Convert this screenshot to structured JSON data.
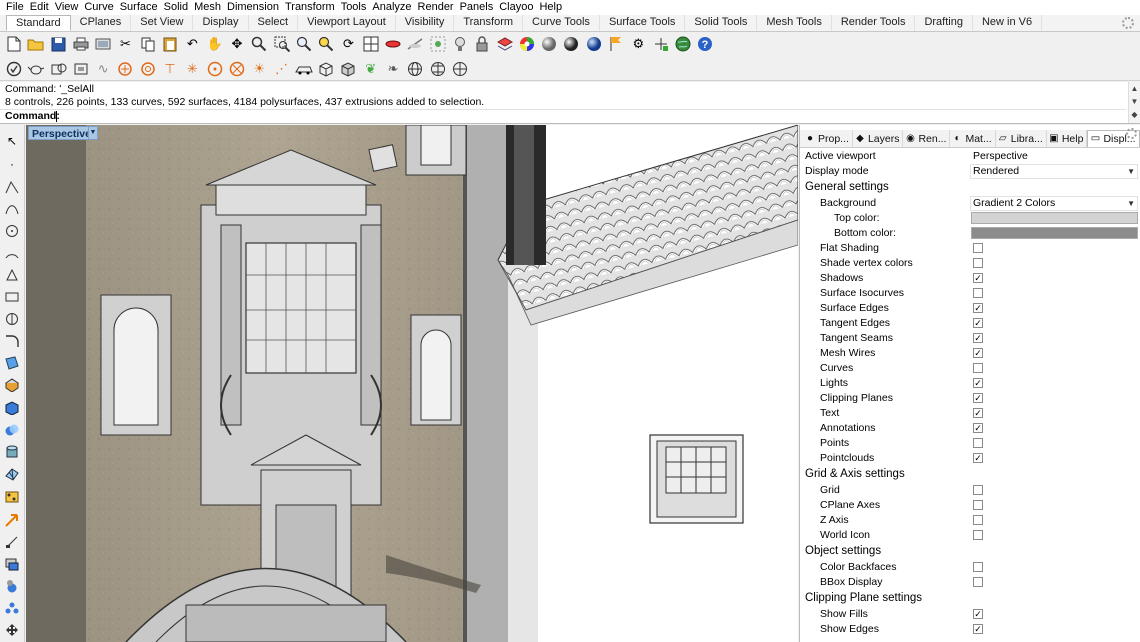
{
  "menu": [
    "File",
    "Edit",
    "View",
    "Curve",
    "Surface",
    "Solid",
    "Mesh",
    "Dimension",
    "Transform",
    "Tools",
    "Analyze",
    "Render",
    "Panels",
    "Clayoo",
    "Help"
  ],
  "tabs": [
    "Standard",
    "CPlanes",
    "Set View",
    "Display",
    "Select",
    "Viewport Layout",
    "Visibility",
    "Transform",
    "Curve Tools",
    "Surface Tools",
    "Solid Tools",
    "Mesh Tools",
    "Render Tools",
    "Drafting",
    "New in V6"
  ],
  "active_tab": "Standard",
  "command": {
    "line1": "Command: '_SelAll",
    "line2": "8 controls, 226 points, 133 curves, 592 surfaces, 4184 polysurfaces, 437 extrusions added to selection.",
    "prompt": "Command:"
  },
  "viewport": {
    "title": "Perspective"
  },
  "panel_tabs": [
    {
      "label": "Prop...",
      "icon": "properties-icon"
    },
    {
      "label": "Layers",
      "icon": "layers-icon"
    },
    {
      "label": "Ren...",
      "icon": "rendering-icon"
    },
    {
      "label": "Mat...",
      "icon": "materials-icon"
    },
    {
      "label": "Libra...",
      "icon": "libraries-icon"
    },
    {
      "label": "Help",
      "icon": "help-icon"
    },
    {
      "label": "Displ...",
      "icon": "display-icon"
    }
  ],
  "props": {
    "active_viewport_label": "Active viewport",
    "active_viewport_value": "Perspective",
    "display_mode_label": "Display mode",
    "display_mode_value": "Rendered",
    "general_settings": "General settings",
    "background_label": "Background",
    "background_value": "Gradient 2 Colors",
    "top_color_label": "Top color:",
    "bottom_color_label": "Bottom color:",
    "top_color": "#d3d3d3",
    "bottom_color": "#8c8c8c",
    "general_checks": [
      {
        "label": "Flat Shading",
        "checked": false
      },
      {
        "label": "Shade vertex colors",
        "checked": false
      },
      {
        "label": "Shadows",
        "checked": true
      },
      {
        "label": "Surface Isocurves",
        "checked": false
      },
      {
        "label": "Surface Edges",
        "checked": true
      },
      {
        "label": "Tangent Edges",
        "checked": true
      },
      {
        "label": "Tangent Seams",
        "checked": true
      },
      {
        "label": "Mesh Wires",
        "checked": true
      },
      {
        "label": "Curves",
        "checked": false
      },
      {
        "label": "Lights",
        "checked": true
      },
      {
        "label": "Clipping Planes",
        "checked": true
      },
      {
        "label": "Text",
        "checked": true
      },
      {
        "label": "Annotations",
        "checked": true
      },
      {
        "label": "Points",
        "checked": false
      },
      {
        "label": "Pointclouds",
        "checked": true
      }
    ],
    "grid_settings": "Grid & Axis settings",
    "grid_checks": [
      {
        "label": "Grid",
        "checked": false
      },
      {
        "label": "CPlane Axes",
        "checked": false
      },
      {
        "label": "Z Axis",
        "checked": false
      },
      {
        "label": "World Icon",
        "checked": false
      }
    ],
    "object_settings": "Object settings",
    "object_checks": [
      {
        "label": "Color Backfaces",
        "checked": false
      },
      {
        "label": "BBox Display",
        "checked": false
      }
    ],
    "clipping_settings": "Clipping Plane settings",
    "clipping_checks": [
      {
        "label": "Show Fills",
        "checked": true
      },
      {
        "label": "Show Edges",
        "checked": true
      }
    ]
  }
}
